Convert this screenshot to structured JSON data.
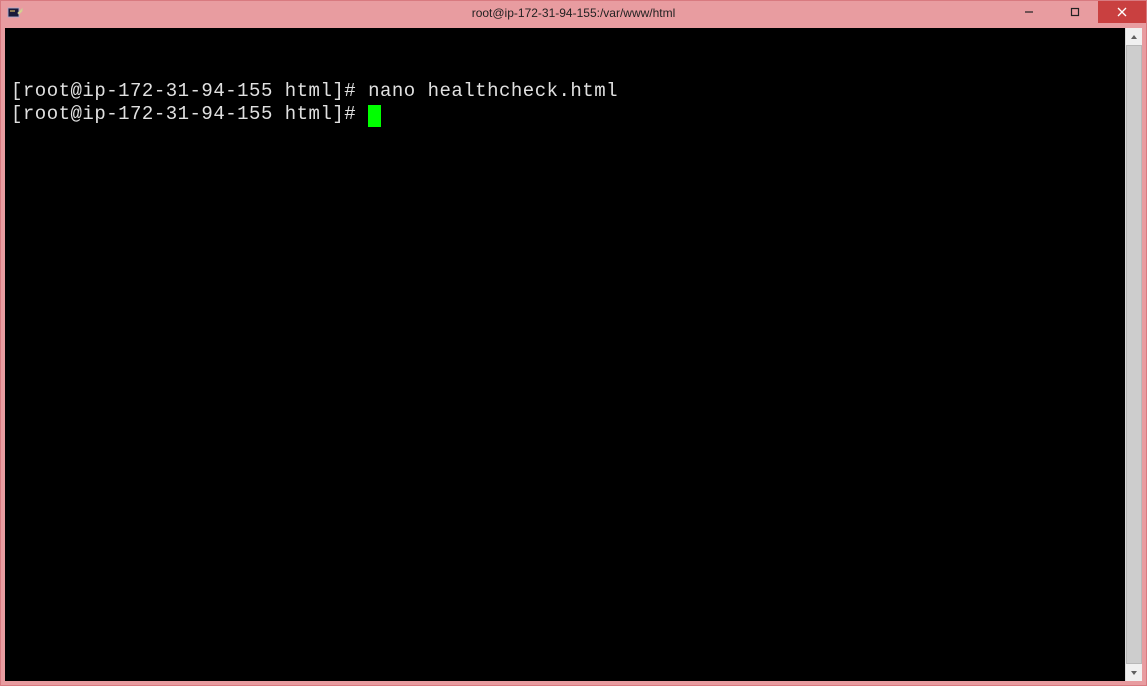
{
  "window": {
    "title": "root@ip-172-31-94-155:/var/www/html",
    "app_icon": "putty-icon"
  },
  "controls": {
    "minimize": "—",
    "maximize": "▢",
    "close": "✕"
  },
  "terminal": {
    "lines": [
      {
        "prompt": "[root@ip-172-31-94-155 html]# ",
        "command": "nano healthcheck.html"
      },
      {
        "prompt": "[root@ip-172-31-94-155 html]# ",
        "command": ""
      }
    ]
  }
}
